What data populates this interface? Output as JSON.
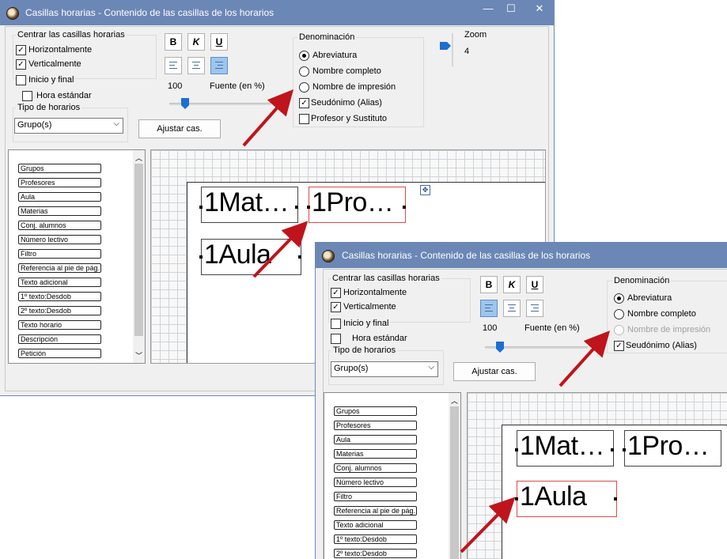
{
  "window1": {
    "title": "Casillas horarias - Contenido de las casillas de los horarios",
    "controls": {
      "minimize": "—",
      "maximize": "☐",
      "close": "✕"
    },
    "centrar": {
      "legend": "Centrar las casillas horarias",
      "horizontalmente": "Horizontalmente",
      "verticalmente": "Verticalmente"
    },
    "inicio_final": "Inicio y final",
    "hora_estandar": "Hora estándar",
    "tipo_horarios": {
      "legend": "Tipo de horarios",
      "value": "Grupo(s)"
    },
    "format_buttons": {
      "bold": "B",
      "italic": "K",
      "underline": "U"
    },
    "fuente": {
      "value": "100",
      "label": "Fuente (en %)",
      "slider_percent": 18
    },
    "ajustar": "Ajustar cas.",
    "denominacion": {
      "legend": "Denominación",
      "options": [
        "Abreviatura",
        "Nombre completo",
        "Nombre de impresión"
      ],
      "selected": "Abreviatura",
      "seudonimo": "Seudónimo (Alias)",
      "profesor": "Profesor y Sustituto"
    },
    "zoom": {
      "label": "Zoom",
      "value": "4"
    },
    "list_items": [
      "Grupos",
      "Profesores",
      "Aula",
      "Materias",
      "Conj. alumnos",
      "Número lectivo",
      "Filtro",
      "Referencia al pie de pág.",
      "Texto adicional",
      "1º texto:Desdob",
      "2º texto:Desdob",
      "Texto horario",
      "Descripción",
      "Petición"
    ],
    "cells": {
      "c1": "1Mat…",
      "c2": "1Pro…",
      "c3": "1Aula"
    }
  },
  "window2": {
    "title": "Casillas horarias - Contenido de las casillas de los horarios",
    "centrar": {
      "legend": "Centrar las casillas horarias",
      "horizontalmente": "Horizontalmente",
      "verticalmente": "Verticalmente"
    },
    "inicio_final": "Inicio y final",
    "hora_estandar": "Hora estándar",
    "tipo_horarios": {
      "legend": "Tipo de horarios",
      "value": "Grupo(s)"
    },
    "format_buttons": {
      "bold": "B",
      "italic": "K",
      "underline": "U"
    },
    "fuente": {
      "value": "100",
      "label": "Fuente (en %)",
      "slider_percent": 18
    },
    "ajustar": "Ajustar cas.",
    "denominacion": {
      "legend": "Denominación",
      "options": [
        "Abreviatura",
        "Nombre completo",
        "Nombre de impresión"
      ],
      "selected": "Abreviatura",
      "disabled": "Nombre de impresión",
      "seudonimo": "Seudónimo (Alias)"
    },
    "list_items": [
      "Grupos",
      "Profesores",
      "Aula",
      "Materias",
      "Conj. alumnos",
      "Número lectivo",
      "Filtro",
      "Referencia al pie de pág.",
      "Texto adicional",
      "1º texto:Desdob",
      "2º texto:Desdob"
    ],
    "cells": {
      "c1": "1Mat…",
      "c2": "1Pro…",
      "c3": "1Aula"
    }
  },
  "colors": {
    "titlebar": "#6b87b5",
    "arrow": "#c0141c",
    "accent": "#1a6fd0",
    "selection": "#e04a4a"
  },
  "icons": {
    "app": "clock-icon",
    "bold": "bold-icon",
    "italic": "italic-icon",
    "underline": "underline-icon",
    "align_left": "align-left-icon",
    "align_center": "align-center-icon",
    "align_right": "align-right-icon",
    "move": "move-icon",
    "scroll_up": "chevron-up-icon",
    "scroll_down": "chevron-down-icon"
  }
}
